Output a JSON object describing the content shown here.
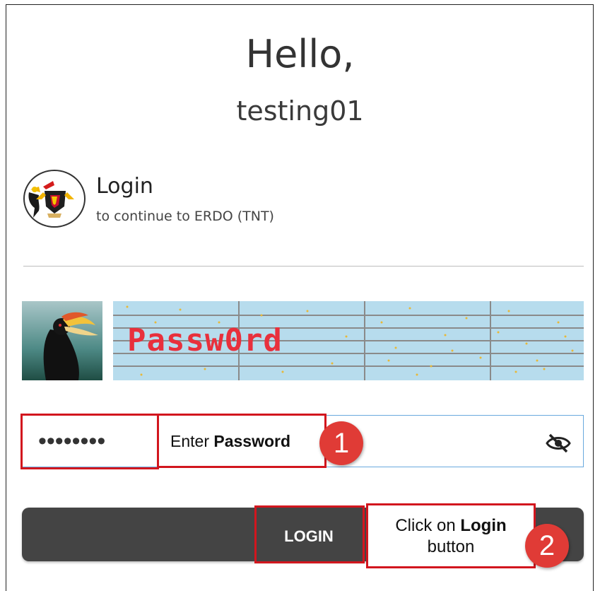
{
  "header": {
    "greeting": "Hello,",
    "username": "testing01"
  },
  "login_panel": {
    "title": "Login",
    "subtitle": "to continue to ERDO (TNT)",
    "logo_icon": "hornbill-crest-icon"
  },
  "captcha": {
    "image_icon": "hornbill-bird-image",
    "text": "Passw0rd"
  },
  "password_field": {
    "value": "••••••••",
    "toggle_icon": "eye-slash-icon"
  },
  "login_button": {
    "label": "LOGIN"
  },
  "annotations": {
    "step1": {
      "number": "1",
      "text_pre": "Enter ",
      "text_bold": "Password"
    },
    "step2": {
      "number": "2",
      "line1_pre": "Click on ",
      "line1_bold": "Login",
      "line2": "button"
    }
  },
  "colors": {
    "highlight_red": "#d2161e",
    "badge_red": "#e03b36",
    "button_dark": "#444444",
    "input_border_blue": "#69a9de"
  }
}
